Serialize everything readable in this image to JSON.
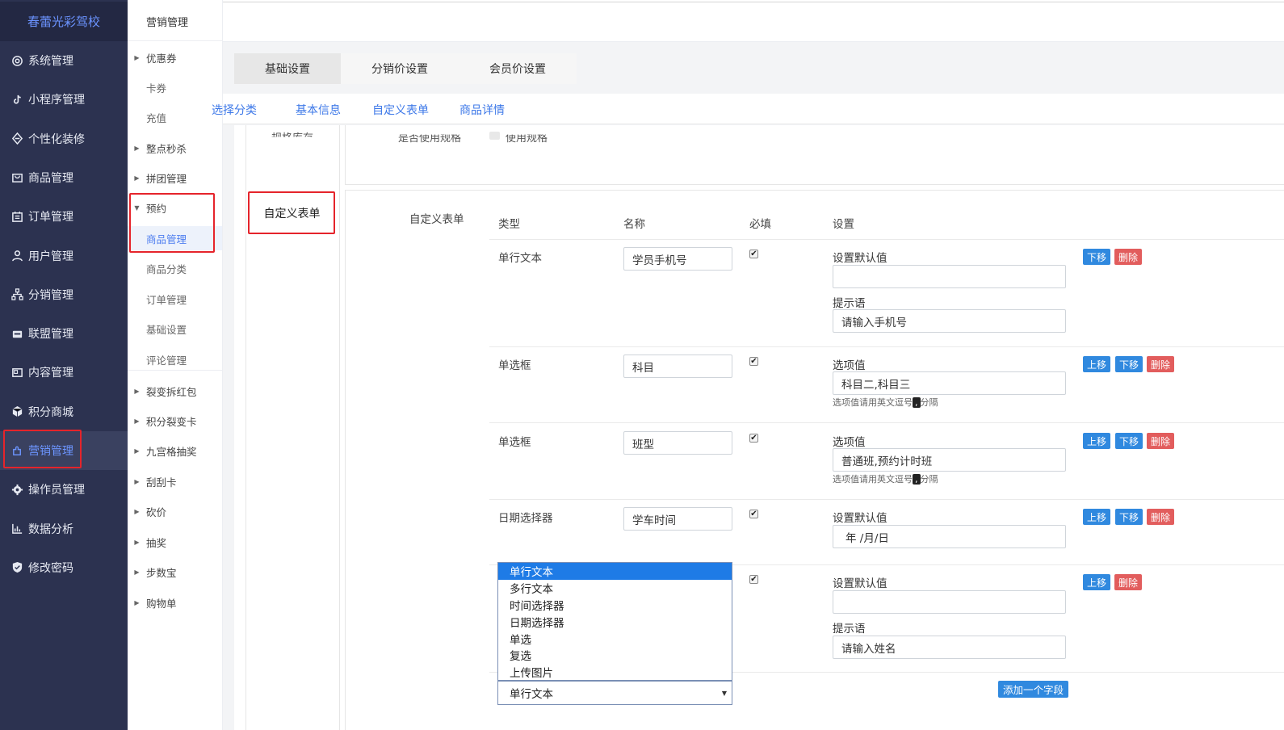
{
  "brand": "春蕾光彩驾校",
  "sidebar": {
    "items": [
      {
        "label": "系统管理",
        "icon": "settings-icon"
      },
      {
        "label": "小程序管理",
        "icon": "tiktok-icon"
      },
      {
        "label": "个性化装修",
        "icon": "decoration-icon"
      },
      {
        "label": "商品管理",
        "icon": "bag-icon"
      },
      {
        "label": "订单管理",
        "icon": "calendar-icon"
      },
      {
        "label": "用户管理",
        "icon": "user-icon"
      },
      {
        "label": "分销管理",
        "icon": "hierarchy-icon"
      },
      {
        "label": "联盟管理",
        "icon": "store-icon"
      },
      {
        "label": "内容管理",
        "icon": "content-icon"
      },
      {
        "label": "积分商城",
        "icon": "cube-icon"
      },
      {
        "label": "营销管理",
        "icon": "puzzle-icon"
      },
      {
        "label": "操作员管理",
        "icon": "gear-icon"
      },
      {
        "label": "数据分析",
        "icon": "chart-icon"
      },
      {
        "label": "修改密码",
        "icon": "shield-icon"
      }
    ],
    "active_index": 10,
    "accent": "#6c95ff"
  },
  "subnav": {
    "title": "营销管理",
    "items": [
      {
        "label": "优惠券",
        "caret": "right"
      },
      {
        "label": "卡券",
        "child": true
      },
      {
        "label": "充值",
        "child": true
      },
      {
        "label": "整点秒杀",
        "caret": "right"
      },
      {
        "label": "拼团管理",
        "caret": "right"
      },
      {
        "label": "预约",
        "caret": "down"
      },
      {
        "label": "商品管理",
        "child": true,
        "active": true
      },
      {
        "label": "商品分类",
        "child": true
      },
      {
        "label": "订单管理",
        "child": true
      },
      {
        "label": "基础设置",
        "child": true
      },
      {
        "label": "评论管理",
        "child": true
      },
      {
        "label": "裂变拆红包",
        "caret": "right"
      },
      {
        "label": "积分裂变卡",
        "caret": "right"
      },
      {
        "label": "九宫格抽奖",
        "caret": "right"
      },
      {
        "label": "刮刮卡",
        "caret": "right"
      },
      {
        "label": "砍价",
        "caret": "right"
      },
      {
        "label": "抽奖",
        "caret": "right"
      },
      {
        "label": "步数宝",
        "caret": "right"
      },
      {
        "label": "购物单",
        "caret": "right"
      }
    ]
  },
  "tabs_primary": [
    "基础设置",
    "分销价设置",
    "会员价设置"
  ],
  "tabs_secondary": [
    "选择分类",
    "基本信息",
    "自定义表单",
    "商品详情"
  ],
  "cut_row": {
    "left": "规格库存",
    "label": "是否使用规格",
    "checkbox_label": "使用规格"
  },
  "section": {
    "title": "自定义表单",
    "form_label": "自定义表单"
  },
  "table": {
    "headers": [
      "类型",
      "名称",
      "必填",
      "设置"
    ],
    "rows": [
      {
        "type": "单行文本",
        "name": "学员手机号",
        "required": true,
        "s1_label": "设置默认值",
        "s1_value": "",
        "s2_label": "提示语",
        "s2_value": "请输入手机号",
        "buttons": [
          "下移",
          "删除"
        ]
      },
      {
        "type": "单选框",
        "name": "科目",
        "required": true,
        "s1_label": "选项值",
        "s1_value": "科目二,科目三",
        "hint_a": "选项值请用英文逗号",
        "hint_b": "分隔",
        "buttons": [
          "上移",
          "下移",
          "删除"
        ]
      },
      {
        "type": "单选框",
        "name": "班型",
        "required": true,
        "s1_label": "选项值",
        "s1_value": "普通班,预约计时班",
        "hint_a": "选项值请用英文逗号",
        "hint_b": "分隔",
        "buttons": [
          "上移",
          "下移",
          "删除"
        ]
      },
      {
        "type": "日期选择器",
        "name": "学车时间",
        "required": true,
        "s1_label": "设置默认值",
        "s1_value": "年 /月/日",
        "buttons": [
          "上移",
          "下移",
          "删除"
        ]
      },
      {
        "type": "",
        "name": "",
        "required": true,
        "s1_label": "设置默认值",
        "s1_value": "",
        "s2_label": "提示语",
        "s2_value": "请输入姓名",
        "buttons": [
          "上移",
          "删除"
        ]
      }
    ]
  },
  "dropdown": {
    "options": [
      "单行文本",
      "多行文本",
      "时间选择器",
      "日期选择器",
      "单选",
      "复选",
      "上传图片"
    ],
    "selected": "单行文本"
  },
  "add_field_button": "添加一个字段",
  "colors": {
    "sidebar": "#2c3250",
    "link": "#3d78e8",
    "primary_btn": "#3089df",
    "danger_btn": "#e25d5d",
    "highlight": "#e5242b"
  }
}
